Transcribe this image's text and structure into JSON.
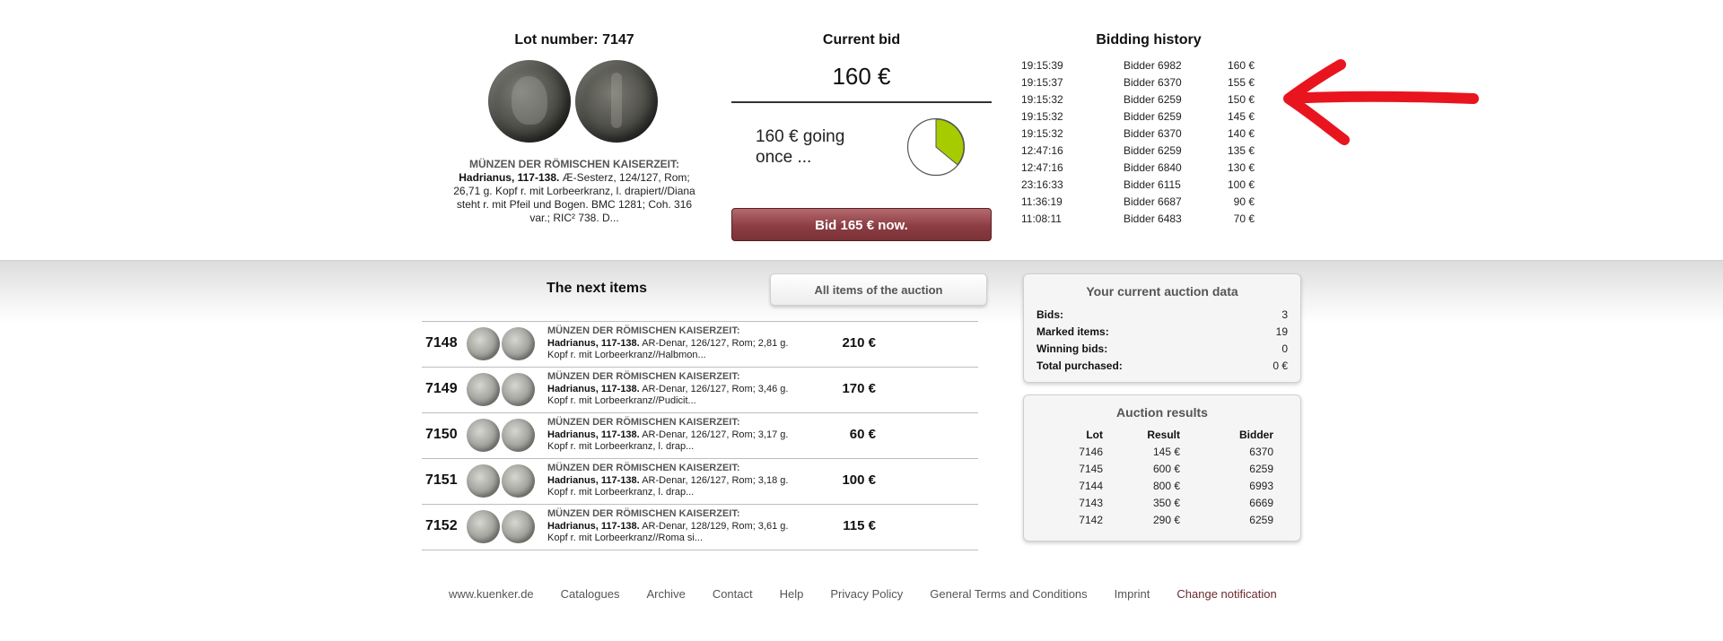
{
  "lot": {
    "title": "Lot number: 7147",
    "category": "MÜNZEN DER RÖMISCHEN KAISERZEIT:",
    "ruler": "Hadrianus, 117-138.",
    "description": "Æ-Sesterz, 124/127, Rom; 26,71 g. Kopf r. mit Lorbeerkranz, l. drapiert//Diana steht r. mit Pfeil und Bogen. BMC 1281; Coh. 316 var.; RIC² 738. D..."
  },
  "current_bid": {
    "title": "Current bid",
    "amount": "160 €",
    "status": "160 € going once ...",
    "timer_fraction_remaining": 0.36,
    "timer_color": "#a6cc00",
    "button_label": "Bid 165 € now."
  },
  "history": {
    "title": "Bidding history",
    "rows": [
      {
        "time": "19:15:39",
        "bidder": "Bidder 6982",
        "amount": "160 €"
      },
      {
        "time": "19:15:37",
        "bidder": "Bidder 6370",
        "amount": "155 €"
      },
      {
        "time": "19:15:32",
        "bidder": "Bidder 6259",
        "amount": "150 €"
      },
      {
        "time": "19:15:32",
        "bidder": "Bidder 6259",
        "amount": "145 €"
      },
      {
        "time": "19:15:32",
        "bidder": "Bidder 6370",
        "amount": "140 €"
      },
      {
        "time": "12:47:16",
        "bidder": "Bidder 6259",
        "amount": "135 €"
      },
      {
        "time": "12:47:16",
        "bidder": "Bidder 6840",
        "amount": "130 €"
      },
      {
        "time": "23:16:33",
        "bidder": "Bidder 6115",
        "amount": "100 €"
      },
      {
        "time": "11:36:19",
        "bidder": "Bidder 6687",
        "amount": "90 €"
      },
      {
        "time": "11:08:11",
        "bidder": "Bidder 6483",
        "amount": "70 €"
      }
    ]
  },
  "annotation": {
    "arrow_color": "#e8151f"
  },
  "next_items": {
    "title": "The next items",
    "all_items_label": "All items of the auction",
    "items": [
      {
        "lot": "7148",
        "category": "MÜNZEN DER RÖMISCHEN KAISERZEIT:",
        "ruler": "Hadrianus, 117-138.",
        "text": "AR-Denar, 126/127, Rom; 2,81 g. Kopf r. mit Lorbeerkranz//Halbmon...",
        "price": "210 €"
      },
      {
        "lot": "7149",
        "category": "MÜNZEN DER RÖMISCHEN KAISERZEIT:",
        "ruler": "Hadrianus, 117-138.",
        "text": "AR-Denar, 126/127, Rom; 3,46 g. Kopf r. mit Lorbeerkranz//Pudicit...",
        "price": "170 €"
      },
      {
        "lot": "7150",
        "category": "MÜNZEN DER RÖMISCHEN KAISERZEIT:",
        "ruler": "Hadrianus, 117-138.",
        "text": "AR-Denar, 126/127, Rom; 3,17 g. Kopf r. mit Lorbeerkranz, l. drap...",
        "price": "60 €"
      },
      {
        "lot": "7151",
        "category": "MÜNZEN DER RÖMISCHEN KAISERZEIT:",
        "ruler": "Hadrianus, 117-138.",
        "text": "AR-Denar, 126/127, Rom; 3,18 g. Kopf r. mit Lorbeerkranz, l. drap...",
        "price": "100 €"
      },
      {
        "lot": "7152",
        "category": "MÜNZEN DER RÖMISCHEN KAISERZEIT:",
        "ruler": "Hadrianus, 117-138.",
        "text": "AR-Denar, 128/129, Rom; 3,61 g. Kopf r. mit Lorbeerkranz//Roma si...",
        "price": "115 €"
      }
    ]
  },
  "auction_data": {
    "title": "Your current auction data",
    "rows": [
      {
        "label": "Bids:",
        "value": "3"
      },
      {
        "label": "Marked items:",
        "value": "19"
      },
      {
        "label": "Winning bids:",
        "value": "0"
      },
      {
        "label": "Total purchased:",
        "value": "0 €"
      }
    ]
  },
  "auction_results": {
    "title": "Auction results",
    "headers": {
      "lot": "Lot",
      "result": "Result",
      "bidder": "Bidder"
    },
    "rows": [
      {
        "lot": "7146",
        "result": "145 €",
        "bidder": "6370"
      },
      {
        "lot": "7145",
        "result": "600 €",
        "bidder": "6259"
      },
      {
        "lot": "7144",
        "result": "800 €",
        "bidder": "6993"
      },
      {
        "lot": "7143",
        "result": "350 €",
        "bidder": "6669"
      },
      {
        "lot": "7142",
        "result": "290 €",
        "bidder": "6259"
      }
    ]
  },
  "footer": {
    "links": [
      "www.kuenker.de",
      "Catalogues",
      "Archive",
      "Contact",
      "Help",
      "Privacy Policy",
      "General Terms and Conditions",
      "Imprint",
      "Change notification"
    ]
  }
}
